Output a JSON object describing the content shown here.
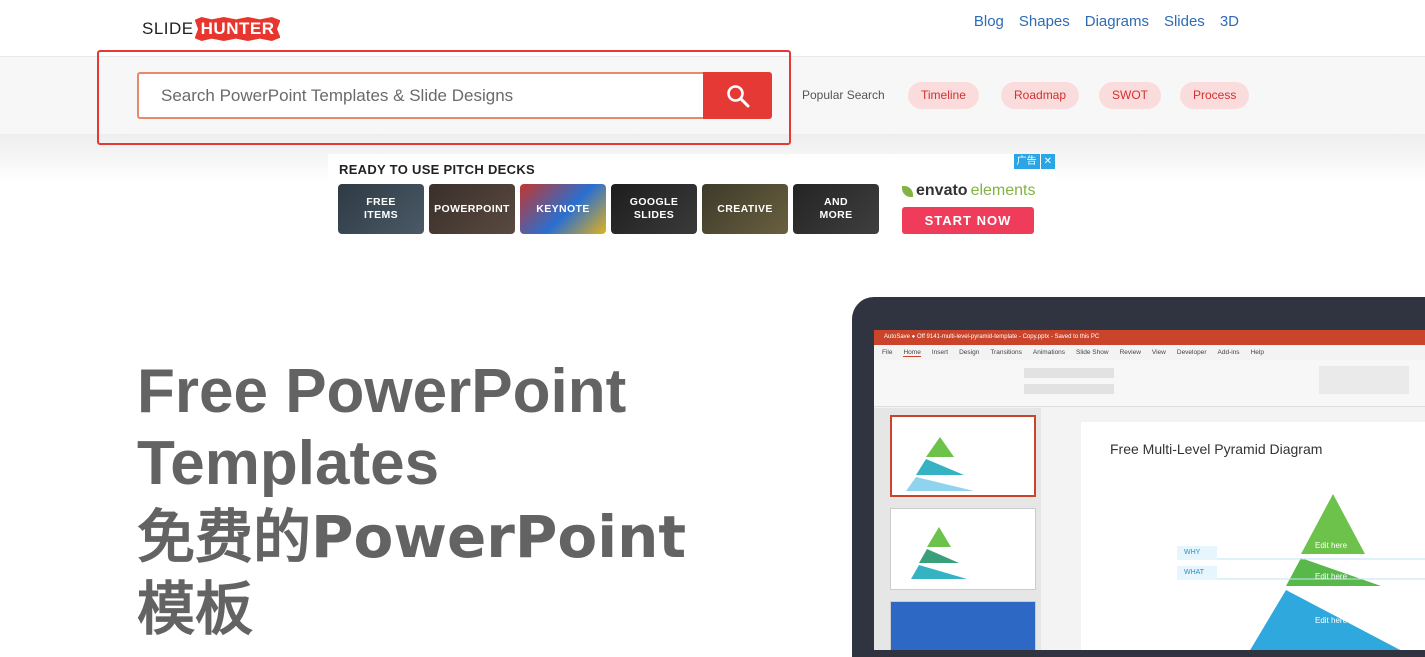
{
  "header": {
    "logo": {
      "part1": "SLIDE",
      "part2": "HUNTER"
    },
    "nav": [
      "Blog",
      "Shapes",
      "Diagrams",
      "Slides",
      "3D"
    ]
  },
  "search": {
    "placeholder": "Search PowerPoint Templates & Slide Designs",
    "popular_label": "Popular Search",
    "popular_tags": [
      "Timeline",
      "Roadmap",
      "SWOT",
      "Process"
    ]
  },
  "ad": {
    "title": "READY TO USE PITCH DECKS",
    "badge_label": "广告",
    "close_symbol": "✕",
    "tiles": [
      {
        "label_line1": "FREE",
        "label_line2": "ITEMS"
      },
      {
        "label_line1": "POWERPOINT",
        "label_line2": ""
      },
      {
        "label_line1": "KEYNOTE",
        "label_line2": ""
      },
      {
        "label_line1": "GOOGLE",
        "label_line2": "SLIDES"
      },
      {
        "label_line1": "CREATIVE",
        "label_line2": ""
      },
      {
        "label_line1": "AND",
        "label_line2": "MORE"
      }
    ],
    "brand": {
      "bold": "envato",
      "light": "elements"
    },
    "cta": "START NOW"
  },
  "hero": {
    "line1": "Free PowerPoint",
    "line2": "Templates",
    "line3": "免费的PowerPoint",
    "line4": "模板"
  },
  "preview": {
    "title_bar": "AutoSave  ● Off   9141-multi-level-pyramid-template - Copy.pptx - Saved to this PC",
    "tabs": [
      "File",
      "Home",
      "Insert",
      "Design",
      "Transitions",
      "Animations",
      "Slide Show",
      "Review",
      "View",
      "Developer",
      "Add-ins",
      "Help"
    ],
    "slide_title": "Free Multi-Level Pyramid Diagram",
    "labels": [
      "WHY",
      "WHAT"
    ],
    "pyramid_labels": [
      "Edit here",
      "Edit here",
      "Edit here"
    ]
  },
  "colors": {
    "accent": "#e53935",
    "nav_link": "#2e6bb5",
    "pill_bg": "#fbdcdc",
    "hero_text": "#636363"
  }
}
